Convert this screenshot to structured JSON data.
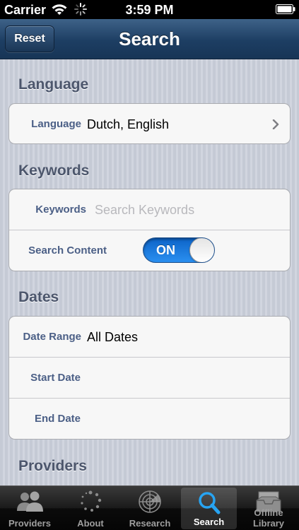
{
  "status_bar": {
    "carrier": "Carrier",
    "time": "3:59 PM"
  },
  "nav": {
    "reset_label": "Reset",
    "title": "Search"
  },
  "sections": {
    "language": {
      "header": "Language",
      "label": "Language",
      "value": "Dutch, English"
    },
    "keywords": {
      "header": "Keywords",
      "keywords_label": "Keywords",
      "keywords_placeholder": "Search Keywords",
      "search_content_label": "Search Content",
      "toggle_text": "ON"
    },
    "dates": {
      "header": "Dates",
      "date_range_label": "Date Range",
      "date_range_value": "All Dates",
      "start_date_label": "Start Date",
      "end_date_label": "End Date"
    },
    "providers": {
      "header": "Providers"
    }
  },
  "tabs": [
    {
      "label": "Providers",
      "icon": "people-icon"
    },
    {
      "label": "About",
      "icon": "dots-circle-icon"
    },
    {
      "label": "Research",
      "icon": "radar-icon"
    },
    {
      "label": "Search",
      "icon": "magnifier-icon",
      "selected": true
    },
    {
      "label": "Offline Library",
      "icon": "inbox-tray-icon"
    }
  ],
  "colors": {
    "nav_bar": "#1d3e63",
    "toggle_on": "#1a7ae0",
    "row_label": "#4b5f86",
    "section_header": "#4c566c"
  }
}
